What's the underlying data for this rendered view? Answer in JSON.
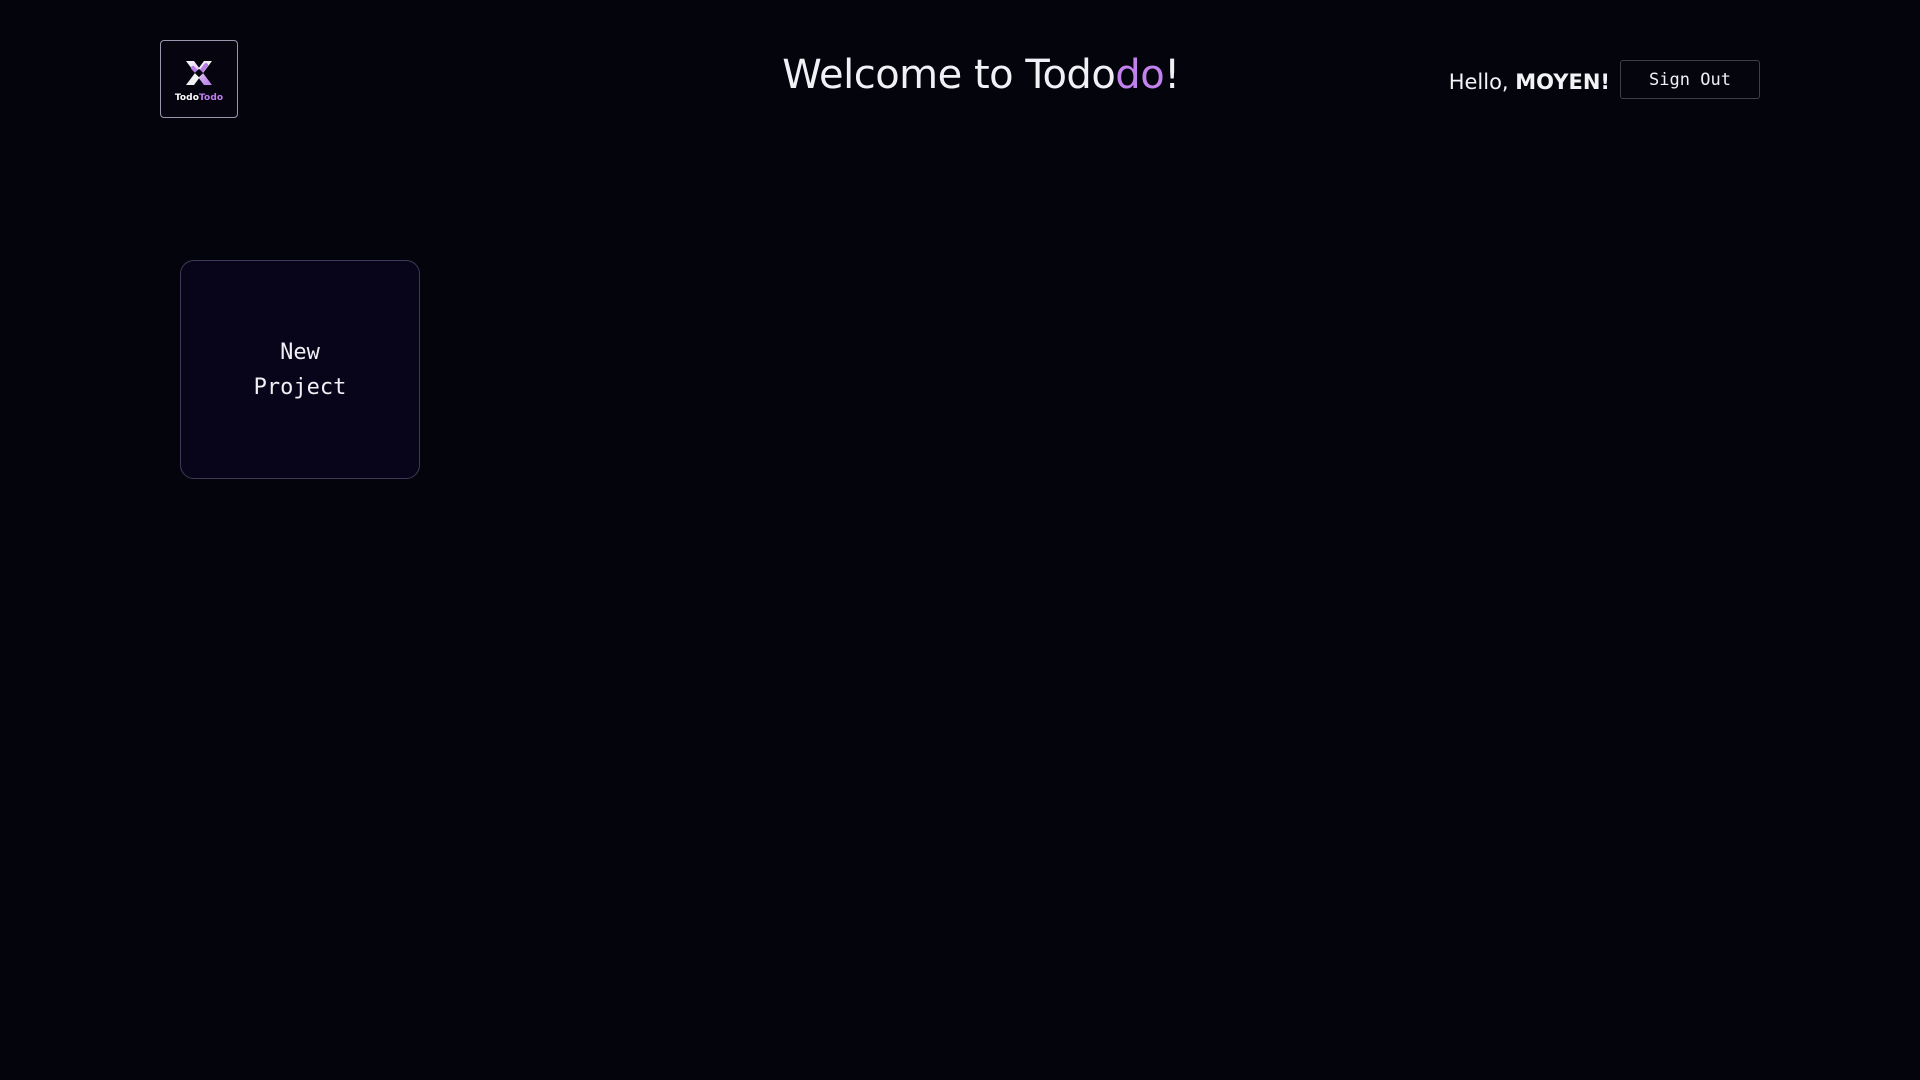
{
  "header": {
    "logo": {
      "icon": "tododo-logo-icon",
      "text_part1": "Todo",
      "text_part2": "Todo"
    },
    "title": {
      "prefix": "Welcome to Todo",
      "accent": "do",
      "suffix": "!"
    },
    "greeting": {
      "prefix": "Hello, ",
      "username": "MOYEN",
      "suffix": "!"
    },
    "sign_out_label": "Sign Out"
  },
  "projects": {
    "new_project_label": "New Project"
  },
  "colors": {
    "background": "#03040c",
    "accent": "#c381ee",
    "card_background": "#08041a"
  }
}
